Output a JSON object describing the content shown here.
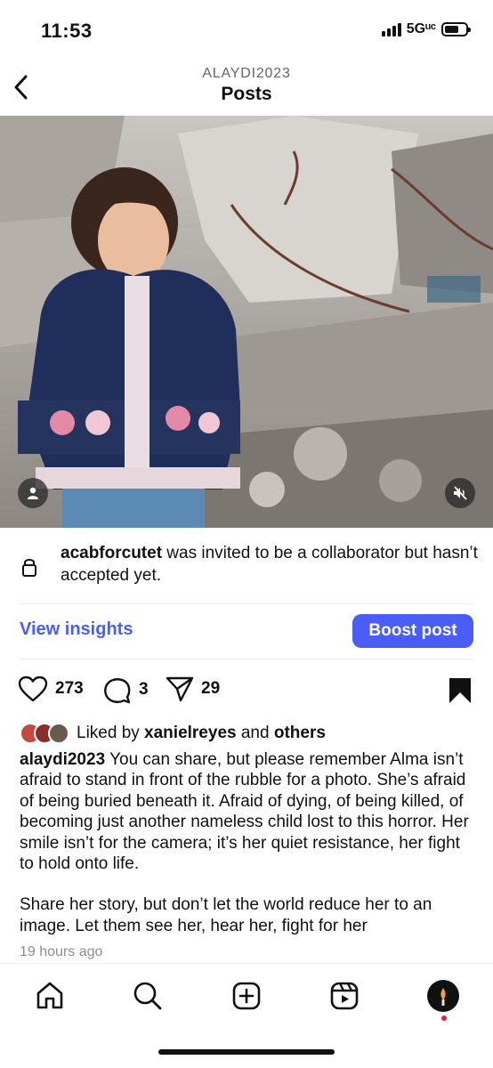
{
  "status_bar": {
    "time": "11:53",
    "network": "5Gᵘᶜ",
    "battery_level": 0.7
  },
  "header": {
    "account": "ALAYDI2023",
    "title": "Posts",
    "back_icon": "chevron-left-icon"
  },
  "photo": {
    "description_icons": [
      "user-tag-icon",
      "speaker-muted-icon"
    ]
  },
  "collab_notice": {
    "username": "acabforcutet",
    "message": " was invited to be a collaborator but hasn’t accepted yet.",
    "icon": "lock-icon"
  },
  "insights": {
    "view_label": "View insights",
    "boost_label": "Boost post"
  },
  "colors": {
    "accent": "#4a5df9",
    "text": "#111111",
    "muted": "#8e8e8e",
    "notification": "#e0203a"
  },
  "actions": {
    "likes": "273",
    "comments": "3",
    "shares": "29",
    "saved": true
  },
  "liked_by": {
    "prefix": "Liked by ",
    "user": "xanielreyes",
    "middle": " and ",
    "others": "others"
  },
  "caption": {
    "username": "alaydi2023",
    "paragraph1": " You can share, but please remember Alma isn’t afraid to stand in front of the rubble for a photo. She’s afraid of being buried beneath it. Afraid of dying, of being killed, of becoming just another nameless child lost to this horror. Her smile isn’t for the camera; it’s her quiet resistance, her fight to hold onto life.",
    "paragraph2": "Share her story, but don’t let the world reduce her to an image. Let them see her, hear her, fight for her"
  },
  "timestamp": "19 hours ago",
  "tabbar": {
    "tabs": [
      "home-icon",
      "search-icon",
      "create-icon",
      "reels-icon",
      "profile-avatar"
    ]
  }
}
